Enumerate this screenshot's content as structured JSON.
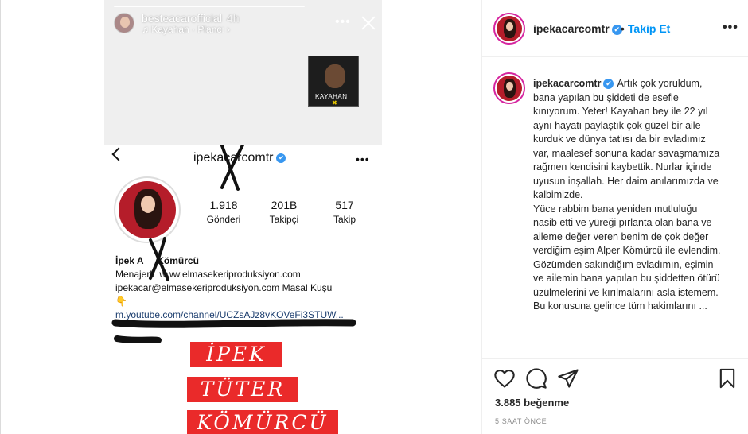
{
  "story": {
    "username": "besteacarofficial",
    "time": "4h",
    "song": "♫ Kayahan · Plancı ›",
    "album_label": "KAYAHAN",
    "more": "•••"
  },
  "screenshot_profile": {
    "username": "ipekacarcomtr",
    "more": "•••",
    "stats": [
      {
        "num": "1.918",
        "label": "Gönderi"
      },
      {
        "num": "201B",
        "label": "Takipçi"
      },
      {
        "num": "517",
        "label": "Takip"
      }
    ],
    "bio_name": "İpek A     Kömürcü",
    "bio_line1": "Menajerli  www.elmasekeriproduksiyon.com",
    "bio_line2": "ipekacar@elmasekeriproduksiyon.com Masal Kuşu",
    "bio_emoji": "👇",
    "bio_link": "m.youtube.com/channel/UCZsAJz8vKOVeFi3STUW...",
    "banners": [
      "İPEK",
      "TÜTER",
      "KÖMÜRCÜ"
    ]
  },
  "panel": {
    "username": "ipekacarcomtr",
    "verified_mark": "✔",
    "follow": "Takip Et",
    "dot": "•",
    "more": "•••",
    "caption_user": "ipekacarcomtr",
    "caption_text": "Artık çok yoruldum, bana yapılan bu şiddeti de esefle kınıyorum. Yeter! Kayahan bey ile 22 yıl aynı hayatı paylaştık çok güzel bir aile kurduk ve dünya tatlısı da bir evladımız var, maalesef sonuna kadar savaşmamıza rağmen kendisini kaybettik. Nurlar içinde uyusun inşallah. Her daim anılarımızda ve kalbimizde.\nYüce rabbim bana yeniden mutluluğu nasib etti ve yüreği pırlanta olan bana ve aileme değer veren benim de çok değer verdiğim eşim Alper Kömürcü ile evlendim. Gözümden sakındığım evladımın, eşimin ve ailemin bana yapılan bu şiddetten ötürü üzülmelerini ve kırılmalarını asla istemem.\nBu konusuna gelince tüm hakimlarını ...",
    "likes": "3.885 beğenme",
    "time_ago": "5 SAAT ÖNCE",
    "icons": [
      "heart-icon",
      "comment-icon",
      "share-icon",
      "bookmark-icon"
    ]
  }
}
